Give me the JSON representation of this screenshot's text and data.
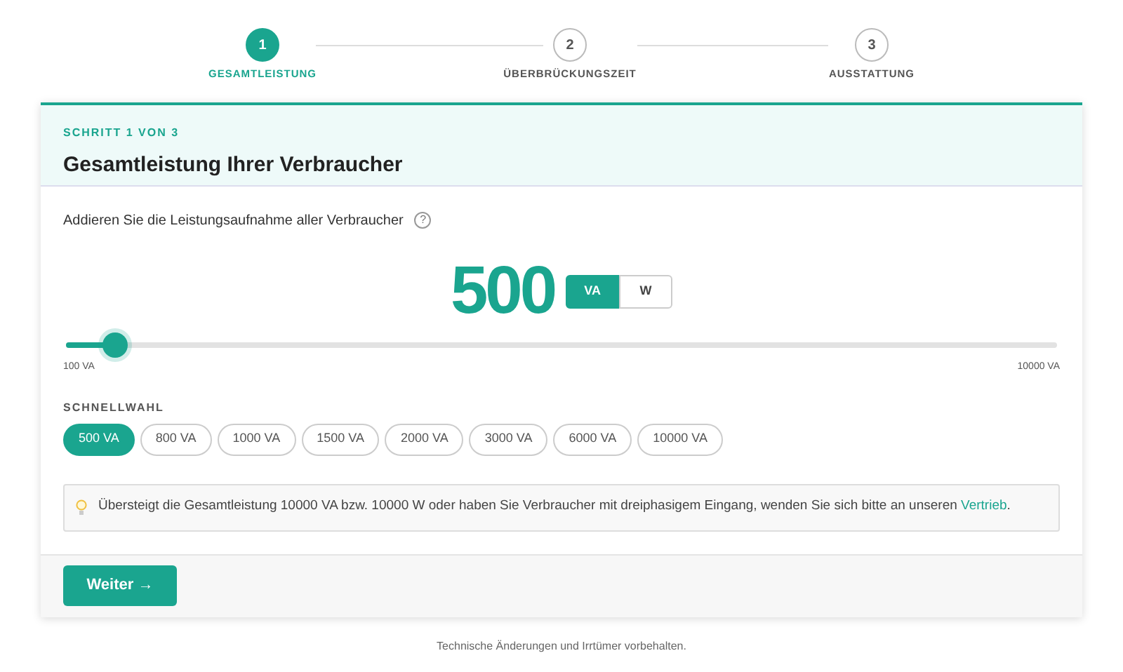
{
  "steps": [
    {
      "number": "1",
      "label": "GESAMTLEISTUNG",
      "selected": true
    },
    {
      "number": "2",
      "label": "ÜBERBRÜCKUNGSZEIT",
      "selected": false
    },
    {
      "number": "3",
      "label": "AUSSTATTUNG",
      "selected": false
    }
  ],
  "card": {
    "step_label": "SCHRITT 1 VON 3",
    "title": "Gesamtleistung Ihrer Verbraucher"
  },
  "prompt": "Addieren Sie die Leistungsaufnahme aller Verbraucher",
  "help": "?",
  "value": "500",
  "units": [
    {
      "label": "VA",
      "selected": true
    },
    {
      "label": "W",
      "selected": false
    }
  ],
  "slider": {
    "level": 0.05,
    "min_label": "100 VA",
    "max_label": "10000 VA"
  },
  "quick_select": {
    "label": "SCHNELLWAHL",
    "options": [
      {
        "label": "500 VA",
        "selected": true
      },
      {
        "label": "800 VA",
        "selected": false
      },
      {
        "label": "1000 VA",
        "selected": false
      },
      {
        "label": "1500 VA",
        "selected": false
      },
      {
        "label": "2000 VA",
        "selected": false
      },
      {
        "label": "3000 VA",
        "selected": false
      },
      {
        "label": "6000 VA",
        "selected": false
      },
      {
        "label": "10000 VA",
        "selected": false
      }
    ]
  },
  "notice": {
    "text": "Übersteigt die Gesamtleistung 10000 VA bzw. 10000 W oder haben Sie Verbraucher mit dreiphasigem Eingang, wenden Sie sich bitte an unseren",
    "link": "Vertrieb",
    "end": "."
  },
  "next_button": "Weiter →",
  "footer": "Technische Änderungen und Irrtümer vorbehalten."
}
